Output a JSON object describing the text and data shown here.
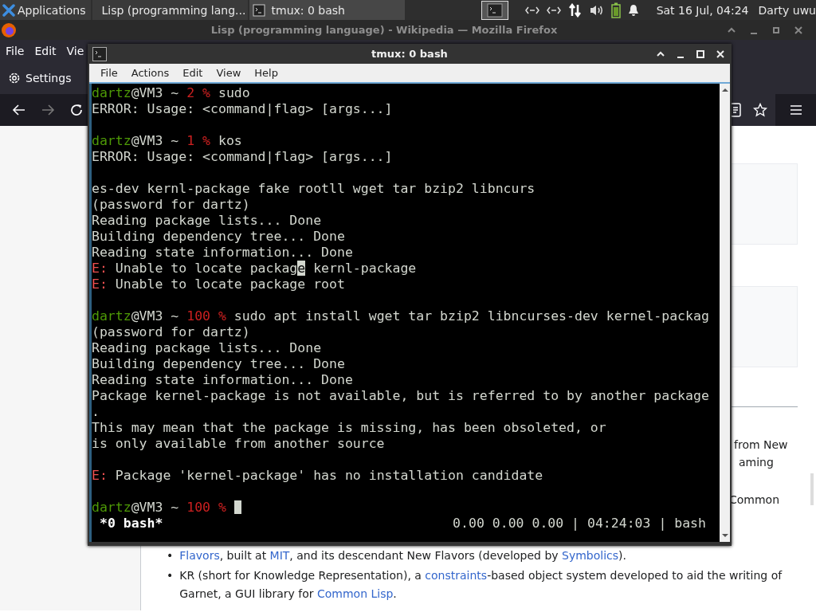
{
  "panel": {
    "apps_label": "Applications",
    "tasks": [
      {
        "label": "Lisp (programming lang...",
        "selected": false
      },
      {
        "label": "tmux: 0 bash",
        "selected": true
      }
    ],
    "clock": "Sat 16 Jul, 04:24",
    "user": "Darty uwu"
  },
  "firefox": {
    "title": "Lisp (programming language) - Wikipedia — Mozilla Firefox",
    "menu": [
      "File",
      "Edit",
      "Vie"
    ],
    "settings_label": "Settings",
    "fragments": [
      "from New",
      "aming",
      "Common"
    ],
    "bullets": [
      {
        "marker": "•",
        "segments": [
          {
            "text": "Flavors",
            "kind": "link"
          },
          {
            "text": ", built at ",
            "kind": "text"
          },
          {
            "text": "MIT",
            "kind": "link"
          },
          {
            "text": ", and its descendant New Flavors (developed by ",
            "kind": "text"
          },
          {
            "text": "Symbolics",
            "kind": "link"
          },
          {
            "text": ").",
            "kind": "text"
          }
        ]
      },
      {
        "marker": "•",
        "segments": [
          {
            "text": "KR (short for Knowledge Representation), a ",
            "kind": "text"
          },
          {
            "text": "constraints",
            "kind": "link"
          },
          {
            "text": "-based object system developed to aid the writing of Garnet, a GUI library for ",
            "kind": "text"
          },
          {
            "text": "Common Lisp",
            "kind": "link"
          },
          {
            "text": ".",
            "kind": "text"
          }
        ]
      }
    ]
  },
  "terminal": {
    "title": "tmux: 0 bash",
    "menu": [
      "File",
      "Actions",
      "Edit",
      "View",
      "Help"
    ],
    "blocks": [
      {
        "lines": [
          [
            {
              "text": "dartz",
              "kind": "user"
            },
            {
              "text": "@VM3 ~ ",
              "kind": "text"
            },
            {
              "text": "2 %",
              "kind": "red"
            },
            {
              "text": " sudo",
              "kind": "text"
            }
          ],
          [
            {
              "text": "ERROR: Usage: <command|flag> [args...]",
              "kind": "text"
            }
          ]
        ]
      },
      {
        "lines": [
          [
            {
              "text": "dartz",
              "kind": "user"
            },
            {
              "text": "@VM3 ~ ",
              "kind": "text"
            },
            {
              "text": "1 %",
              "kind": "red"
            },
            {
              "text": " kos",
              "kind": "text"
            }
          ],
          [
            {
              "text": "ERROR: Usage: <command|flag> [args...]",
              "kind": "text"
            }
          ]
        ]
      },
      {
        "lines": [
          [
            {
              "text": "es-dev kernl-package fake rootll wget tar bzip2 libncurs",
              "kind": "text"
            }
          ],
          [
            {
              "text": "(password for dartz)",
              "kind": "text"
            }
          ],
          [
            {
              "text": "Reading package lists... Done",
              "kind": "text"
            }
          ],
          [
            {
              "text": "Building dependency tree... Done",
              "kind": "text"
            }
          ],
          [
            {
              "text": "Reading state information... Done",
              "kind": "text"
            }
          ],
          [
            {
              "text": "E:",
              "kind": "err"
            },
            {
              "text": " Unable to locate packag",
              "kind": "text"
            },
            {
              "text": "e",
              "kind": "cursor"
            },
            {
              "text": " kernl-package",
              "kind": "text"
            }
          ],
          [
            {
              "text": "E:",
              "kind": "err"
            },
            {
              "text": " Unable to locate package root",
              "kind": "text"
            }
          ]
        ]
      },
      {
        "lines": [
          [
            {
              "text": "dartz",
              "kind": "user"
            },
            {
              "text": "@VM3 ~ ",
              "kind": "text"
            },
            {
              "text": "100 %",
              "kind": "red"
            },
            {
              "text": " sudo apt install wget tar bzip2 libncurses-dev kernel-packag",
              "kind": "text"
            }
          ],
          [
            {
              "text": "(password for dartz)",
              "kind": "text"
            }
          ],
          [
            {
              "text": "Reading package lists... Done",
              "kind": "text"
            }
          ],
          [
            {
              "text": "Building dependency tree... Done",
              "kind": "text"
            }
          ],
          [
            {
              "text": "Reading state information... Done",
              "kind": "text"
            }
          ],
          [
            {
              "text": "Package kernel-package is not available, but is referred to by another package",
              "kind": "text"
            }
          ],
          [
            {
              "text": ".",
              "kind": "text"
            }
          ],
          [
            {
              "text": "This may mean that the package is missing, has been obsoleted, or",
              "kind": "text"
            }
          ],
          [
            {
              "text": "is only available from another source",
              "kind": "text"
            }
          ]
        ]
      },
      {
        "lines": [
          [
            {
              "text": "E:",
              "kind": "err"
            },
            {
              "text": " Package 'kernel-package' has no installation candidate",
              "kind": "text"
            }
          ]
        ]
      },
      {
        "lines": [
          [
            {
              "text": "dartz",
              "kind": "user"
            },
            {
              "text": "@VM3 ~ ",
              "kind": "text"
            },
            {
              "text": "100 %",
              "kind": "red"
            }
          ]
        ],
        "cursor": true
      }
    ],
    "status_left": "*0 bash*",
    "status_right": "0.00 0.00 0.00 | 04:24:03 | bash"
  }
}
